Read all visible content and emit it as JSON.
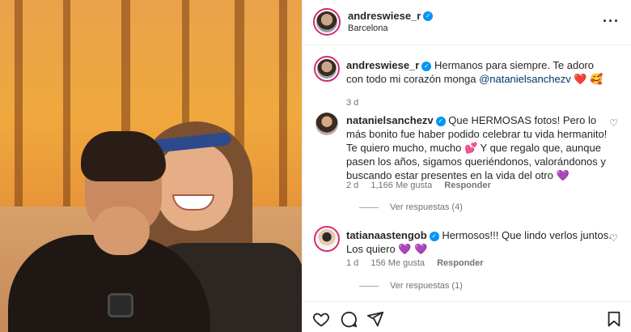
{
  "post": {
    "author": "andreswiese_r",
    "location": "Barcelona",
    "caption_user": "andreswiese_r",
    "caption_text": "Hermanos para siempre. Te adoro con todo mi corazón monga",
    "caption_mention": "@natanielsanchezv",
    "caption_emoji": "❤️ 🥰",
    "caption_time": "3 d"
  },
  "comments": [
    {
      "user": "natanielsanchezv",
      "text": "Que HERMOSAS fotos! Pero lo más bonito fue haber podido celebrar tu vida hermanito! Te quiero mucho, mucho 💕 Y que regalo que, aunque pasen los años, sigamos queriéndonos, valorándonos y buscando estar presentes en la vida del otro 💜",
      "time": "2 d",
      "likes": "1,166 Me gusta",
      "reply": "Responder",
      "view_replies": "Ver respuestas (4)"
    },
    {
      "user": "tatianaastengob",
      "text": "Hermosos!!! Que lindo verlos juntos. Los quiero 💜 💜",
      "time": "1 d",
      "likes": "156 Me gusta",
      "reply": "Responder",
      "view_replies": "Ver respuestas (1)"
    }
  ],
  "icons": {
    "more": "more-options-icon",
    "like": "heart-icon",
    "comment": "comment-icon",
    "share": "share-icon",
    "save": "bookmark-icon",
    "verified": "verified-badge-icon"
  },
  "colors": {
    "verified": "#0095f6",
    "mention": "#00376b",
    "meta": "#737373"
  }
}
